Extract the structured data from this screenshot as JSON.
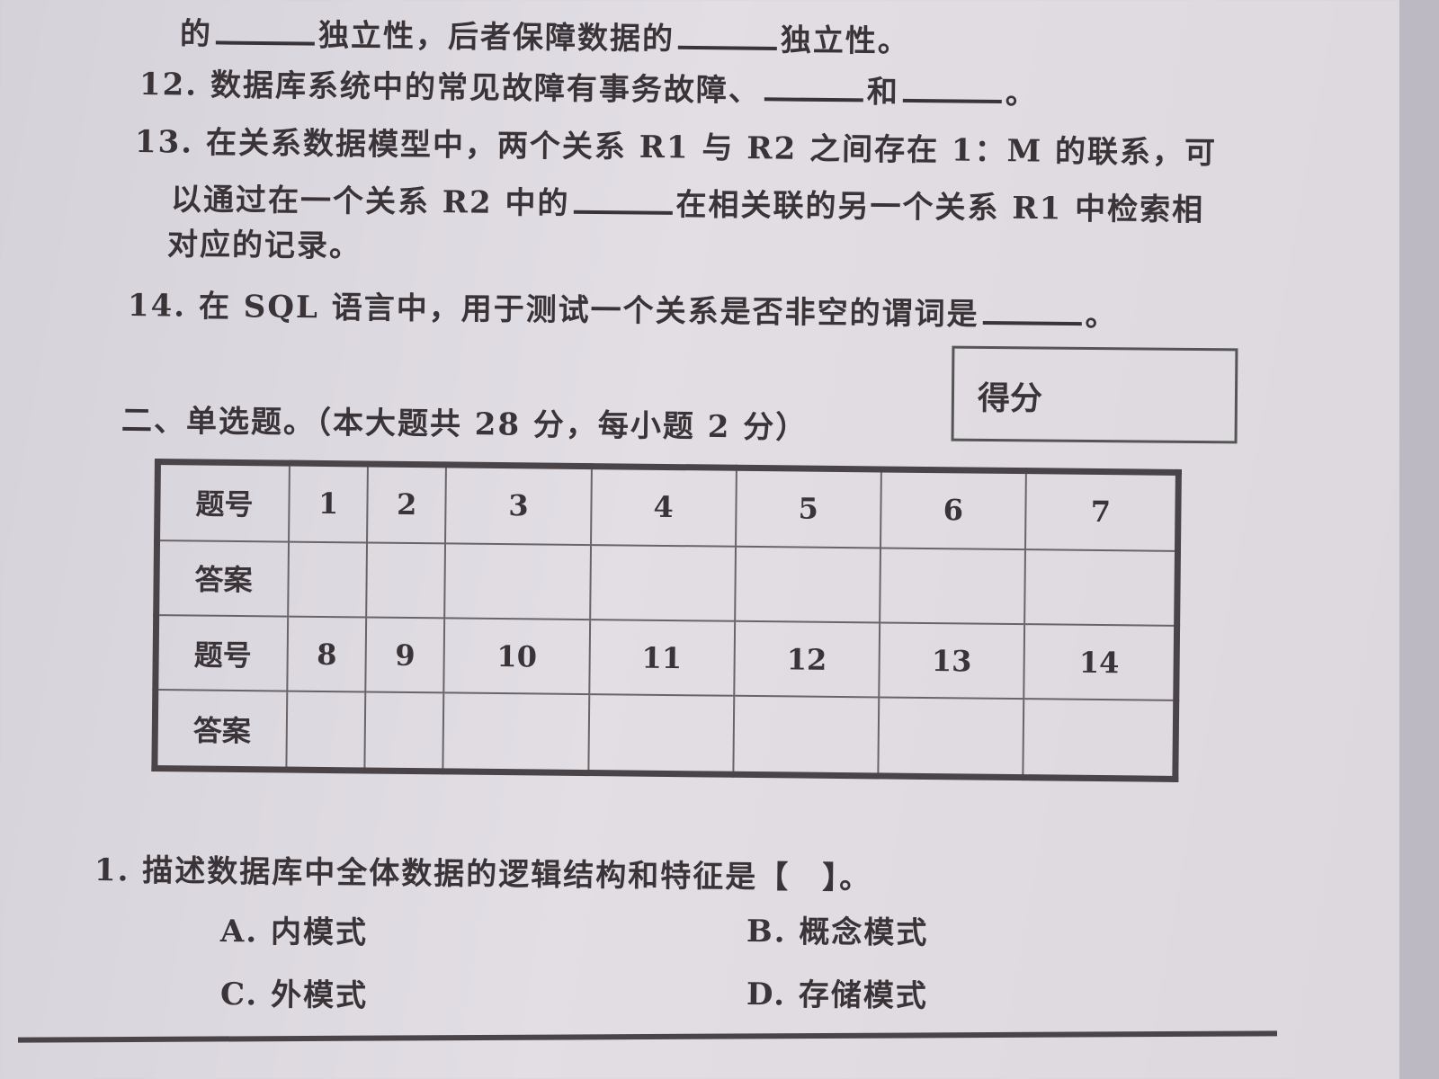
{
  "q11_cont": {
    "before": "的",
    "mid": "独立性，后者保障数据的",
    "after": "独立性。"
  },
  "q12": {
    "text": "12. 数据库系统中的常见故障有事务故障、",
    "mid": "和",
    "end": "。"
  },
  "q13": {
    "line1": "13. 在关系数据模型中，两个关系 R1 与 R2 之间存在 1：M 的联系，可",
    "line2a": "以通过在一个关系 R2 中的",
    "line2b": "在相关联的另一个关系 R1 中检索相",
    "line3": "对应的记录。"
  },
  "q14": {
    "text": "14. 在 SQL 语言中，用于测试一个关系是否非空的谓词是",
    "end": "。"
  },
  "section": {
    "title": "二、单选题。（本大题共 28 分，每小题 2 分）",
    "score_label": "得分"
  },
  "table": {
    "row_label_num": "题号",
    "row_label_ans": "答案",
    "row1": [
      "1",
      "2",
      "3",
      "4",
      "5",
      "6",
      "7"
    ],
    "row2": [
      "8",
      "9",
      "10",
      "11",
      "12",
      "13",
      "14"
    ]
  },
  "mc1": {
    "question": "1. 描述数据库中全体数据的逻辑结构和特征是【　】。",
    "a": "A. 内模式",
    "b": "B. 概念模式",
    "c": "C. 外模式",
    "d": "D. 存储模式"
  }
}
